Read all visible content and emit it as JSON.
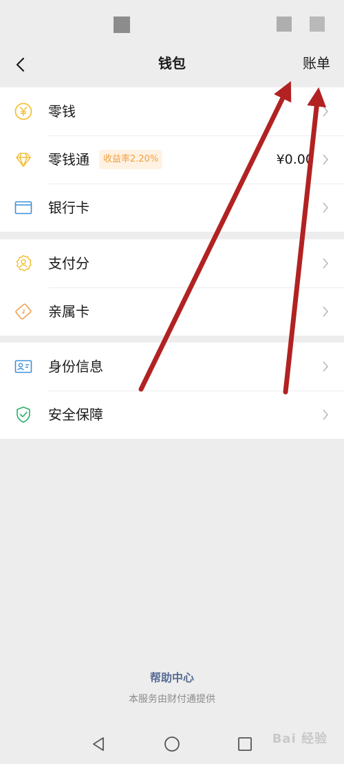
{
  "navbar": {
    "title": "钱包",
    "bill_label": "账单"
  },
  "group1": [
    {
      "label": "零钱",
      "icon": "yen-coin-icon"
    },
    {
      "label": "零钱通",
      "icon": "diamond-icon",
      "badge": "收益率2.20%",
      "value": "¥0.00"
    },
    {
      "label": "银行卡",
      "icon": "bank-card-icon"
    }
  ],
  "group2": [
    {
      "label": "支付分",
      "icon": "pay-score-icon"
    },
    {
      "label": "亲属卡",
      "icon": "family-card-icon"
    }
  ],
  "group3": [
    {
      "label": "身份信息",
      "icon": "id-card-icon"
    },
    {
      "label": "安全保障",
      "icon": "shield-check-icon"
    }
  ],
  "footer": {
    "help_label": "帮助中心",
    "provider_text": "本服务由财付通提供"
  },
  "watermark": "Bai 经验",
  "colors": {
    "background": "#ededed",
    "link": "#576b95",
    "annotation": "#b22222",
    "badge_text": "#f0a040"
  }
}
